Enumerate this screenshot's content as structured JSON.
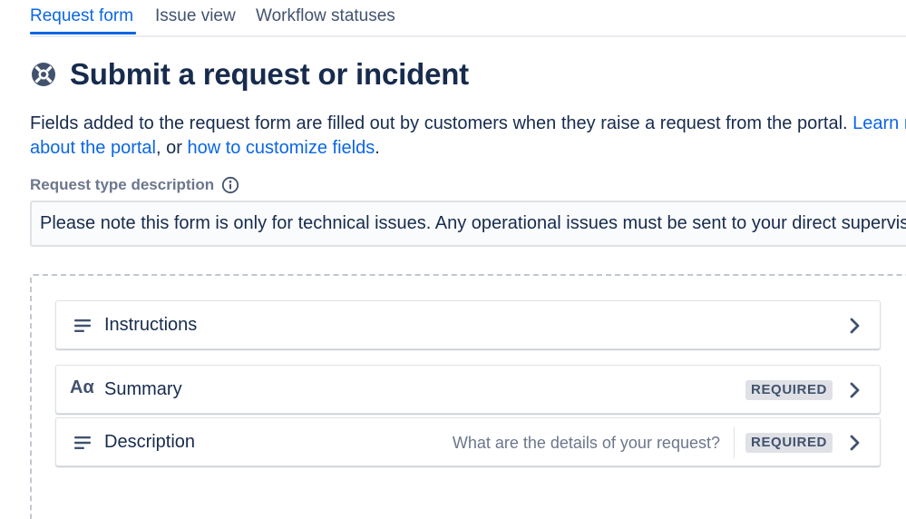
{
  "tabs": [
    {
      "label": "Request form",
      "active": true
    },
    {
      "label": "Issue view",
      "active": false
    },
    {
      "label": "Workflow statuses",
      "active": false
    }
  ],
  "page": {
    "title": "Submit a request or incident",
    "icon": "lifebuoy-icon"
  },
  "intro": {
    "text_before": "Fields added to the request form are filled out by customers when they raise a request from the portal. ",
    "link1_line1": "Learn more",
    "link1_line2": "about the portal",
    "text_between": ", or ",
    "link2": "how to customize fields",
    "text_after": "."
  },
  "description_field": {
    "label": "Request type description",
    "value": "Please note this form is only for technical issues. Any operational issues must be sent to your direct supervisor"
  },
  "fields": [
    {
      "label": "Instructions",
      "icon": "text-lines-icon",
      "hint": "",
      "required": false
    },
    {
      "label": "Summary",
      "icon": "typography-icon",
      "icon_text": "Aα",
      "hint": "",
      "required": true
    },
    {
      "label": "Description",
      "icon": "text-lines-icon",
      "hint": "What are the details of your request?",
      "required": true
    }
  ],
  "required_label": "REQUIRED",
  "colors": {
    "link": "#0c66e4",
    "text": "#172b4d",
    "subtle": "#6b778c",
    "badge_bg": "#dfe1e6"
  }
}
